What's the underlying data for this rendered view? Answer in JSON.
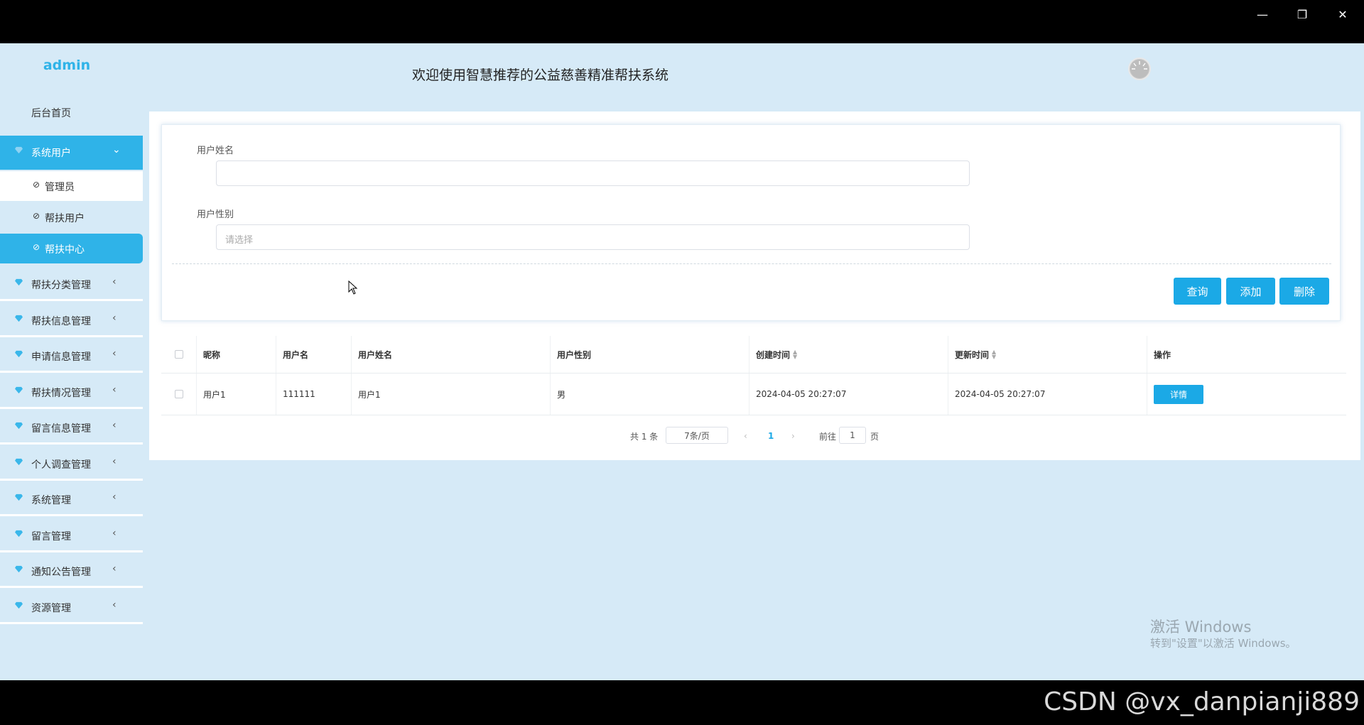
{
  "window": {
    "minimize": "—",
    "restore": "❐",
    "close": "✕"
  },
  "sidebar": {
    "brand": "admin",
    "home": "后台首页",
    "system_user": "系统用户",
    "sub_items": [
      {
        "label": "管理员"
      },
      {
        "label": "帮扶用户"
      },
      {
        "label": "帮扶中心"
      }
    ],
    "menus": [
      {
        "label": "帮扶分类管理"
      },
      {
        "label": "帮扶信息管理"
      },
      {
        "label": "申请信息管理"
      },
      {
        "label": "帮扶情况管理"
      },
      {
        "label": "留言信息管理"
      },
      {
        "label": "个人调查管理"
      },
      {
        "label": "系统管理"
      },
      {
        "label": "留言管理"
      },
      {
        "label": "通知公告管理"
      },
      {
        "label": "资源管理"
      }
    ]
  },
  "header": {
    "title": "欢迎使用智慧推荐的公益慈善精准帮扶系统"
  },
  "search": {
    "name_label": "用户姓名",
    "name_value": "",
    "gender_label": "用户性别",
    "gender_placeholder": "请选择",
    "query": "查询",
    "add": "添加",
    "delete": "删除"
  },
  "table": {
    "columns": [
      "昵称",
      "用户名",
      "用户姓名",
      "用户性别",
      "创建时间",
      "更新时间",
      "操作"
    ],
    "rows": [
      {
        "nickname": "用户1",
        "username": "111111",
        "realname": "用户1",
        "gender": "男",
        "created": "2024-04-05 20:27:07",
        "updated": "2024-04-05 20:27:07",
        "action": "详情"
      }
    ]
  },
  "pagination": {
    "total": "共 1 条",
    "page_size": "7条/页",
    "current": "1",
    "goto_label": "前往",
    "goto_value": "1",
    "page_suffix": "页"
  },
  "watermark": {
    "line1": "激活 Windows",
    "line2": "转到\"设置\"以激活 Windows。"
  },
  "footer": {
    "csdn": "CSDN @vx_danpianji889"
  },
  "colors": {
    "accent": "#1ba9e6",
    "sidebar_active": "#2fb3e8",
    "background": "#d6eaf7"
  }
}
